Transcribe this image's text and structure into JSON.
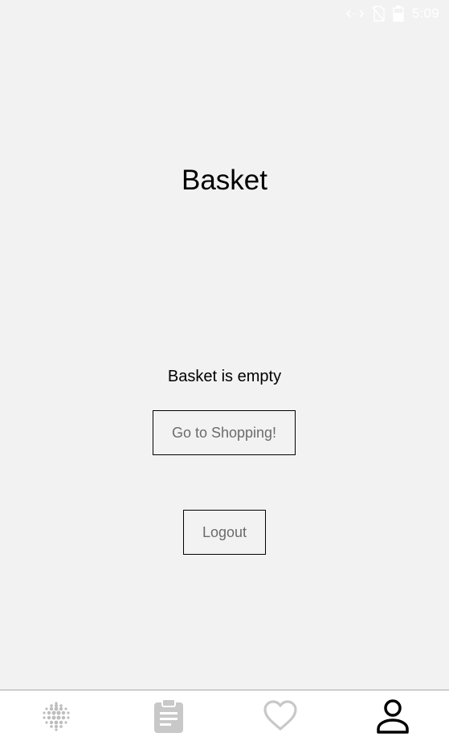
{
  "status_bar": {
    "time": "5:09",
    "icons": [
      "code-arrows-icon",
      "no-sim-icon",
      "battery-icon"
    ]
  },
  "page": {
    "title": "Basket",
    "empty_message": "Basket is empty"
  },
  "actions": {
    "shop_label": "Go to Shopping!",
    "logout_label": "Logout"
  },
  "bottom_nav": {
    "items": [
      {
        "icon": "dots-grid-icon",
        "active": false
      },
      {
        "icon": "clipboard-icon",
        "active": false
      },
      {
        "icon": "heart-icon",
        "active": false
      },
      {
        "icon": "person-icon",
        "active": true
      }
    ]
  },
  "colors": {
    "background": "#f2f2f2",
    "text": "#000000",
    "button_text": "#6b6b6b",
    "nav_inactive": "#c8c8c8",
    "nav_active": "#000000"
  }
}
